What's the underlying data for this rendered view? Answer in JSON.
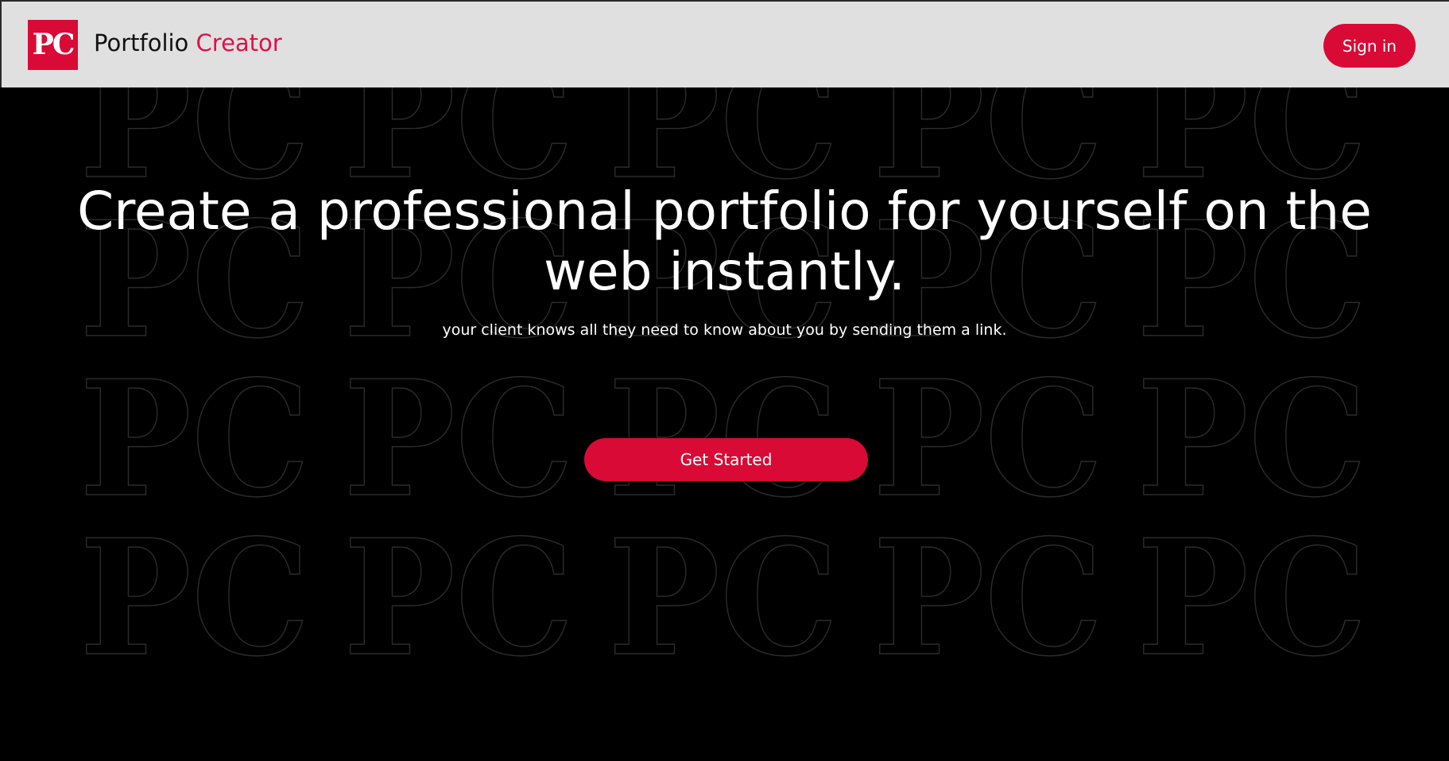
{
  "header": {
    "logo_mark": "PC",
    "brand_part1": "Portfolio",
    "brand_part2": "Creator",
    "signin_label": "Sign in"
  },
  "hero": {
    "title": "Create a professional portfolio for yourself on the web instantly.",
    "subtitle": "your client knows all they need to know about you by sending them a link.",
    "cta_label": "Get Started"
  },
  "background": {
    "pattern_text": "PC"
  },
  "colors": {
    "brand_red": "#d90a35",
    "accent_red": "#e0104a",
    "header_bg": "#e0e0e0",
    "page_bg": "#000000",
    "pattern_stroke": "#2b2b2b"
  }
}
